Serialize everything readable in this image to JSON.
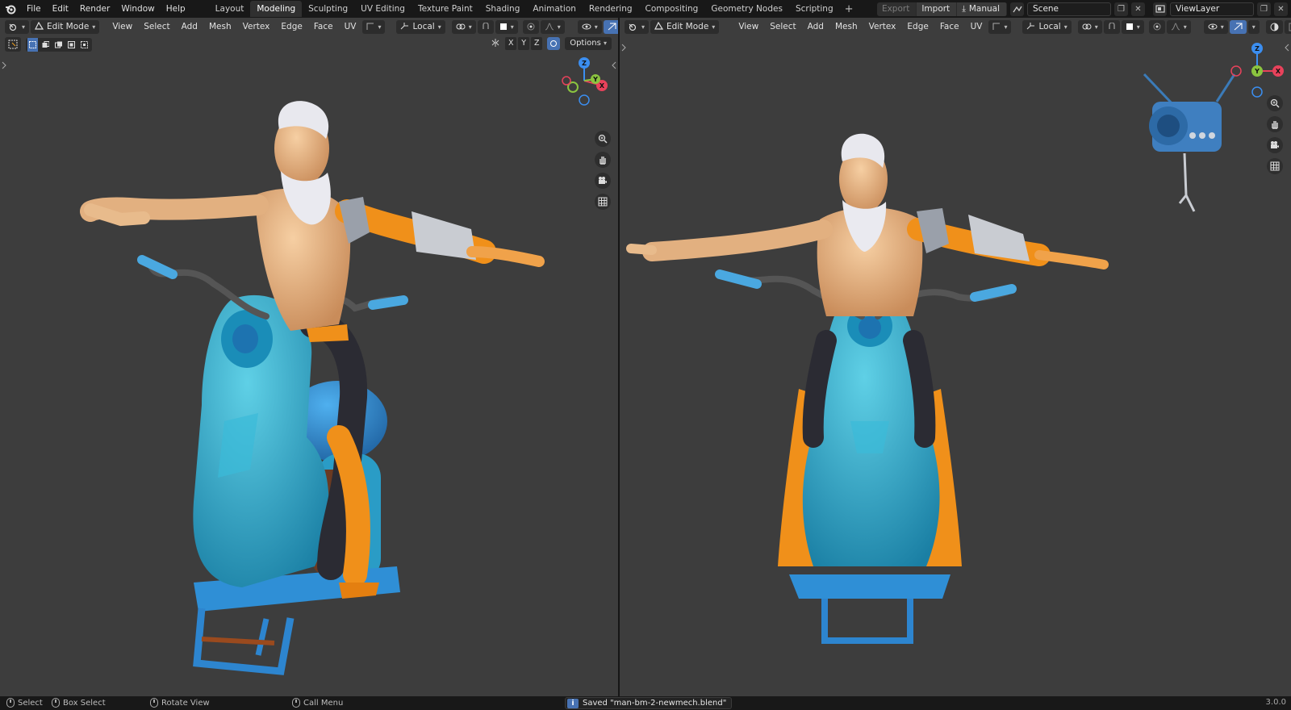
{
  "topbar": {
    "menus": [
      "File",
      "Edit",
      "Render",
      "Window",
      "Help"
    ],
    "workspace_tabs": [
      "Layout",
      "Modeling",
      "Sculpting",
      "UV Editing",
      "Texture Paint",
      "Shading",
      "Animation",
      "Rendering",
      "Compositing",
      "Geometry Nodes",
      "Scripting"
    ],
    "active_tab": "Modeling",
    "add_tab_label": "+",
    "export_label": "Export",
    "import_label": "Import",
    "manual_label": "Manual",
    "scene_name": "Scene",
    "view_layer_name": "ViewLayer"
  },
  "viewport_header": {
    "mode": "Edit Mode",
    "menus": [
      "View",
      "Select",
      "Add",
      "Mesh",
      "Vertex",
      "Edge",
      "Face",
      "UV"
    ],
    "transform_orientation": "Local",
    "options_label": "Options",
    "axis_x": "X",
    "axis_y": "Y",
    "axis_z": "Z"
  },
  "gizmo": {
    "x": "X",
    "y": "Y",
    "z": "Z"
  },
  "status": {
    "select": "Select",
    "box_select": "Box Select",
    "rotate_view": "Rotate View",
    "call_menu": "Call Menu",
    "report": "Saved \"man-bm-2-newmech.blend\"",
    "version": "3.0.0"
  },
  "colors": {
    "viewport_bg": "#3d3d3d",
    "accent_blue": "#4772b3",
    "skin": "#e8b98a",
    "bike_teal": "#2fa8c4",
    "armor_orange": "#f0901a",
    "axis_x": "#e8425b",
    "axis_y": "#8bc43f",
    "axis_z": "#3b8ef0"
  },
  "icons": [
    "blender-logo",
    "editor-type-icon",
    "mode-icon",
    "vertex-select-icon",
    "edge-select-icon",
    "face-select-icon",
    "pivot-icon",
    "snap-icon",
    "proportional-icon",
    "overlay-icon",
    "xray-icon",
    "zoom-icon",
    "hand-icon",
    "camera-icon",
    "grid-icon",
    "info-icon"
  ]
}
